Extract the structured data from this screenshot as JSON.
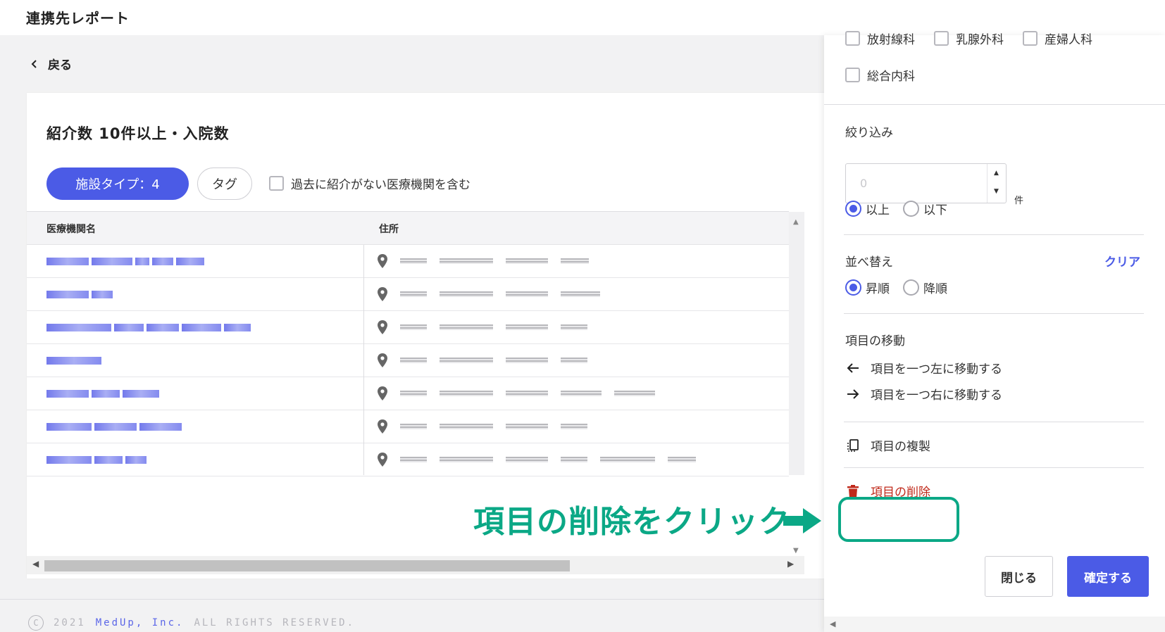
{
  "app": {
    "title": "連携先レポート"
  },
  "nav": {
    "back_label": "戻る"
  },
  "report": {
    "title": "紹介数 10件以上・入院数",
    "chips": {
      "facility_type": "施設タイプ：4",
      "tag": "タグ"
    },
    "include_past_label": "過去に紹介がない医療機関を含む",
    "table": {
      "columns": [
        "医療機関名",
        "住所"
      ]
    }
  },
  "footer": {
    "year": "2021",
    "company": "MedUp, Inc.",
    "rights": "ALL RIGHTS RESERVED."
  },
  "annotation": {
    "text": "項目の削除をクリック",
    "color": "#0ba886"
  },
  "panel": {
    "departments": [
      "放射線科",
      "乳腺外科",
      "産婦人科",
      "総合内科"
    ],
    "filter": {
      "label": "絞り込み",
      "placeholder": "0",
      "unit": "件",
      "above": "以上",
      "below": "以下",
      "selected": "以上"
    },
    "sort": {
      "label": "並べ替え",
      "clear": "クリア",
      "asc": "昇順",
      "desc": "降順",
      "selected": "昇順"
    },
    "move": {
      "label": "項目の移動",
      "left": "項目を一つ左に移動する",
      "right": "項目を一つ右に移動する"
    },
    "duplicate": "項目の複製",
    "delete": "項目の削除",
    "buttons": {
      "close": "閉じる",
      "confirm": "確定する"
    }
  },
  "colors": {
    "primary": "#4b5be6",
    "danger": "#c0291a",
    "accent": "#0ba886"
  }
}
